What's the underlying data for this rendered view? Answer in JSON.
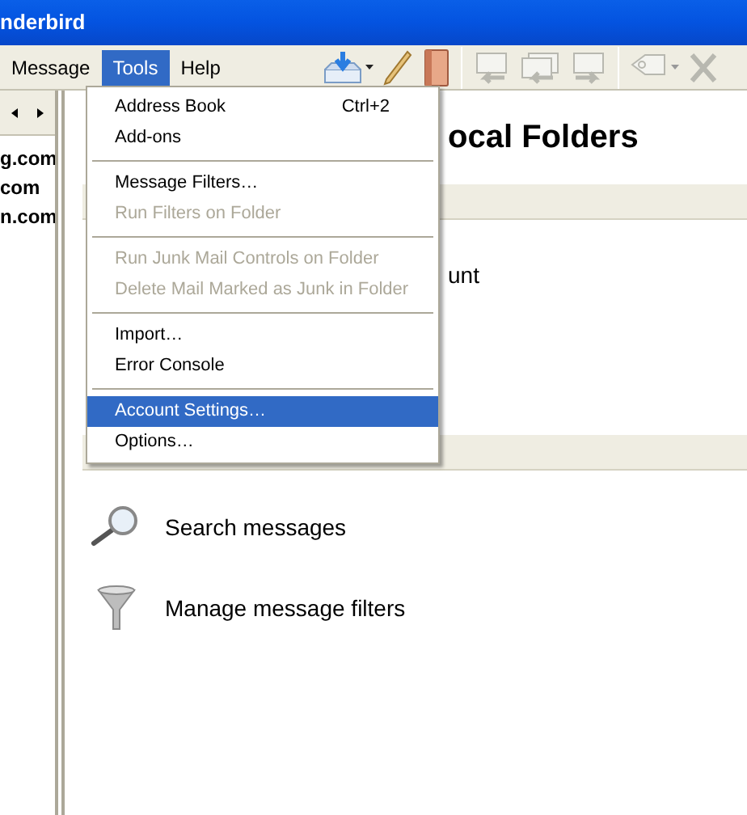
{
  "window": {
    "title": "nderbird"
  },
  "menubar": [
    {
      "label": "Message",
      "selected": false
    },
    {
      "label": "Tools",
      "selected": true
    },
    {
      "label": "Help",
      "selected": false
    }
  ],
  "toolbar": [
    {
      "kind": "get-mail",
      "disabled": false
    },
    {
      "kind": "write",
      "disabled": false
    },
    {
      "kind": "address-book",
      "disabled": false
    },
    {
      "kind": "separator"
    },
    {
      "kind": "reply",
      "disabled": true
    },
    {
      "kind": "reply-all",
      "disabled": true
    },
    {
      "kind": "forward",
      "disabled": true
    },
    {
      "kind": "separator"
    },
    {
      "kind": "tag",
      "disabled": true
    },
    {
      "kind": "delete",
      "disabled": true
    }
  ],
  "folder_pane": {
    "folders": [
      "g.com",
      "com",
      "n.com"
    ]
  },
  "main": {
    "heading": "ocal Folders",
    "account_text": "unt",
    "actions": [
      {
        "kind": "search",
        "label": "Search messages"
      },
      {
        "kind": "filter",
        "label": "Manage message filters"
      }
    ]
  },
  "tools_menu": [
    {
      "kind": "item",
      "label": "Address Book",
      "shortcut": "Ctrl+2",
      "disabled": false,
      "selected": false
    },
    {
      "kind": "item",
      "label": "Add-ons",
      "disabled": false,
      "selected": false
    },
    {
      "kind": "separator"
    },
    {
      "kind": "item",
      "label": "Message Filters…",
      "disabled": false,
      "selected": false
    },
    {
      "kind": "item",
      "label": "Run Filters on Folder",
      "disabled": true,
      "selected": false
    },
    {
      "kind": "separator"
    },
    {
      "kind": "item",
      "label": "Run Junk Mail Controls on Folder",
      "disabled": true,
      "selected": false
    },
    {
      "kind": "item",
      "label": "Delete Mail Marked as Junk in Folder",
      "disabled": true,
      "selected": false
    },
    {
      "kind": "separator"
    },
    {
      "kind": "item",
      "label": "Import…",
      "disabled": false,
      "selected": false
    },
    {
      "kind": "item",
      "label": "Error Console",
      "disabled": false,
      "selected": false
    },
    {
      "kind": "separator"
    },
    {
      "kind": "item",
      "label": "Account Settings…",
      "disabled": false,
      "selected": true
    },
    {
      "kind": "item",
      "label": "Options…",
      "disabled": false,
      "selected": false
    }
  ]
}
